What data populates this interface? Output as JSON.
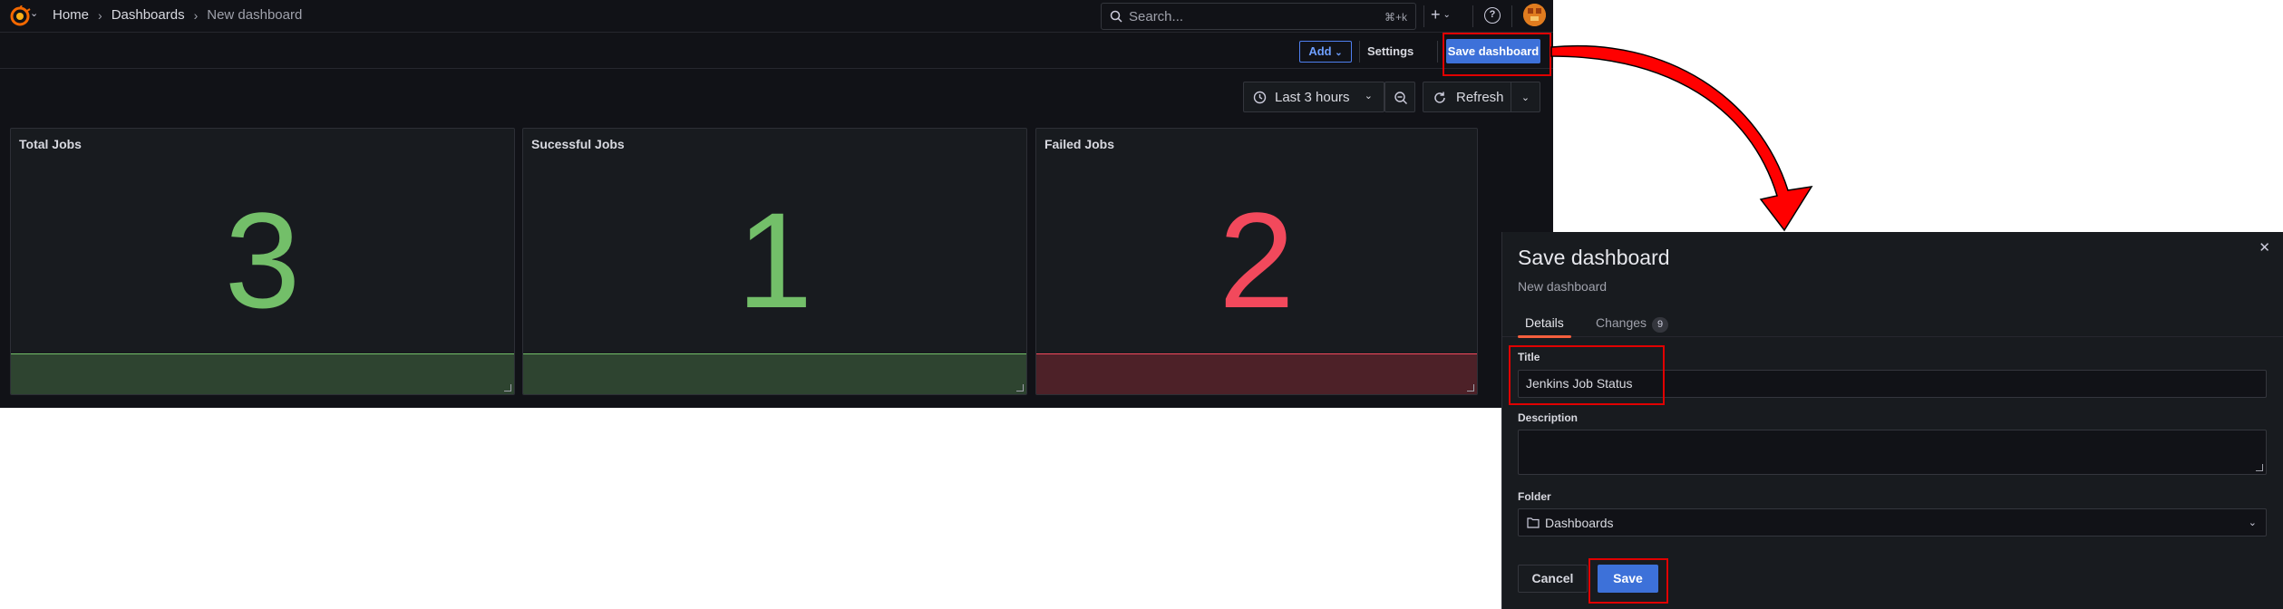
{
  "topnav": {
    "breadcrumbs": [
      "Home",
      "Dashboards",
      "New dashboard"
    ],
    "search_placeholder": "Search...",
    "search_shortcut": "⌘+k",
    "new_label": "+"
  },
  "toolbar": {
    "add_label": "Add",
    "settings_label": "Settings",
    "save_label": "Save dashboard"
  },
  "timebar": {
    "time_range": "Last 3 hours",
    "refresh_label": "Refresh"
  },
  "panels": [
    {
      "title": "Total Jobs",
      "value": "3",
      "color": "#73bf69"
    },
    {
      "title": "Sucessful Jobs",
      "value": "1",
      "color": "#73bf69"
    },
    {
      "title": "Failed Jobs",
      "value": "2",
      "color": "#f2495c"
    }
  ],
  "save_drawer": {
    "heading": "Save dashboard",
    "subheading": "New dashboard",
    "tabs": [
      {
        "label": "Details",
        "active": true
      },
      {
        "label": "Changes",
        "count": "9",
        "active": false
      }
    ],
    "title_label": "Title",
    "title_value": "Jenkins Job Status",
    "description_label": "Description",
    "description_value": "",
    "folder_label": "Folder",
    "folder_value": "Dashboards",
    "cancel_label": "Cancel",
    "save_label": "Save"
  },
  "annotation_color": "#e00000",
  "accent_blue": "#3d71d9"
}
